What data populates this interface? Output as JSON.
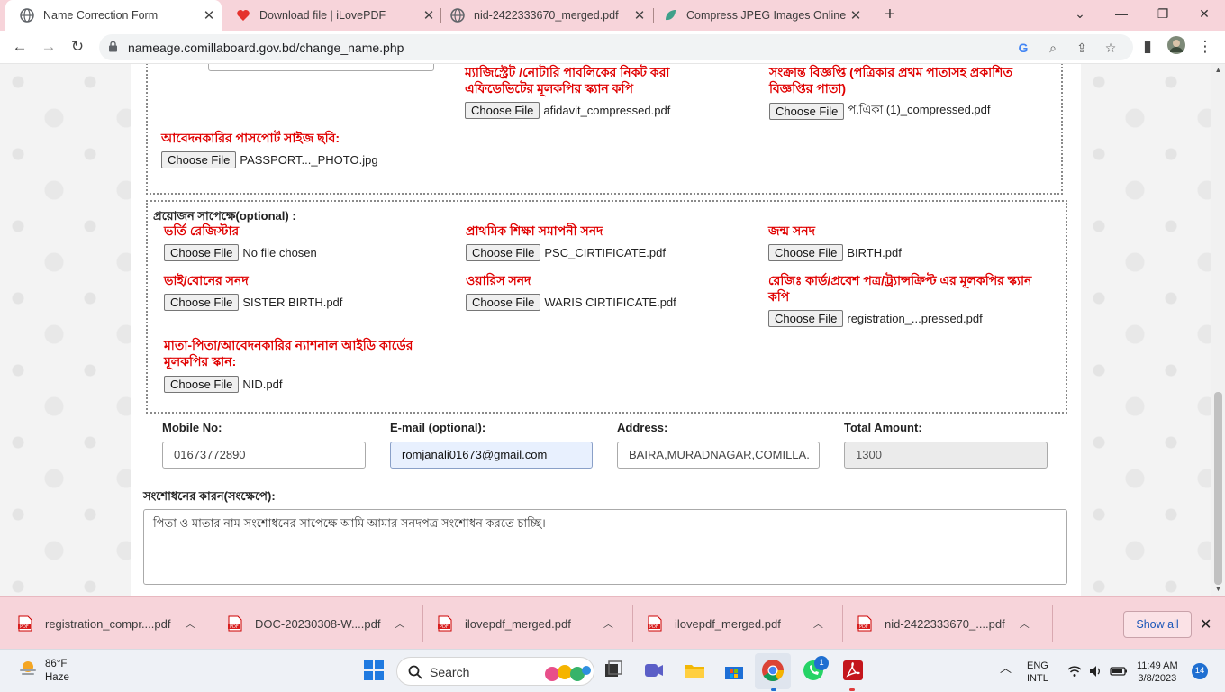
{
  "browser": {
    "tabs": [
      {
        "title": "Name Correction Form",
        "active": true
      },
      {
        "title": "Download file | iLovePDF",
        "active": false
      },
      {
        "title": "nid-2422333670_merged.pdf",
        "active": false
      },
      {
        "title": "Compress JPEG Images Online",
        "active": false
      }
    ],
    "url": "nameage.comillaboard.gov.bd/change_name.php"
  },
  "form": {
    "top_uploads": [
      {
        "label": "ম্যাজিস্ট্রেট /নোটারি পাবলিকের নিকট করা এফিডেভিটের মূলকপির স্ক্যান কপি",
        "button": "Choose File",
        "file": "afidavit_compressed.pdf"
      },
      {
        "label": "সংক্রান্ত বিজ্ঞপ্তি (পত্রিকার প্রথম পাতাসহ প্রকাশিত বিজ্ঞপ্তির পাতা)",
        "button": "Choose File",
        "file": "প.এিকা (1)_compressed.pdf"
      }
    ],
    "photo_upload": {
      "label": "আবেদনকারির পাসপোর্ট সাইজ ছবি:",
      "button": "Choose File",
      "file": "PASSPORT..._PHOTO.jpg"
    },
    "optional": {
      "heading": "প্রয়োজন সাপেক্ষে(optional) :",
      "items": [
        {
          "label": "ভর্তি রেজিস্টার",
          "button": "Choose File",
          "file": "No file chosen"
        },
        {
          "label": "প্রাথমিক শিক্ষা সমাপনী সনদ",
          "button": "Choose File",
          "file": "PSC_CIRTIFICATE.pdf"
        },
        {
          "label": "জন্ম সনদ",
          "button": "Choose File",
          "file": "BIRTH.pdf"
        },
        {
          "label": "ভাই/বোনের সনদ",
          "button": "Choose File",
          "file": "SISTER BIRTH.pdf"
        },
        {
          "label": "ওয়ারিস সনদ",
          "button": "Choose File",
          "file": "WARIS CIRTIFICATE.pdf"
        },
        {
          "label": "রেজিঃ কার্ড/প্রবেশ পত্র/ট্র্যান্সক্রিপ্ট এর মূলকপির স্ক্যান কপি",
          "button": "Choose File",
          "file": "registration_...pressed.pdf"
        },
        {
          "label": "মাতা-পিতা/আবেদনকারির ন্যাশনাল আইডি কার্ডের মূলকপির স্কান:",
          "button": "Choose File",
          "file": "NID.pdf"
        }
      ]
    },
    "contact": {
      "mobile_label": "Mobile No:",
      "mobile_value": "01673772890",
      "email_label": "E-mail (optional):",
      "email_value": "romjanali01673@gmail.com",
      "address_label": "Address:",
      "address_value": "BAIRA,MURADNAGAR,COMILLA.",
      "amount_label": "Total Amount:",
      "amount_value": "1300"
    },
    "reason_label": "সংশোধনের কারন(সংক্ষেপে):",
    "reason_value": "পিতা ও  মাতার নাম সংশোধনের সাপেক্ষে আমি আমার সনদপত্র সংশোধন করতে চাচ্ছি।"
  },
  "downloads": {
    "items": [
      "registration_compr....pdf",
      "DOC-20230308-W....pdf",
      "ilovepdf_merged.pdf",
      "ilovepdf_merged.pdf",
      "nid-2422333670_....pdf"
    ],
    "show_all": "Show all"
  },
  "taskbar": {
    "temperature": "86°F",
    "condition": "Haze",
    "search": "Search",
    "whatsapp_badge": "1",
    "lang_top": "ENG",
    "lang_bottom": "INTL",
    "time": "11:49 AM",
    "date": "3/8/2023",
    "notifications": "14"
  },
  "colors": {
    "tabstrip": "#f7d4da",
    "label_red": "#e00000",
    "link_blue": "#1a56b8"
  }
}
